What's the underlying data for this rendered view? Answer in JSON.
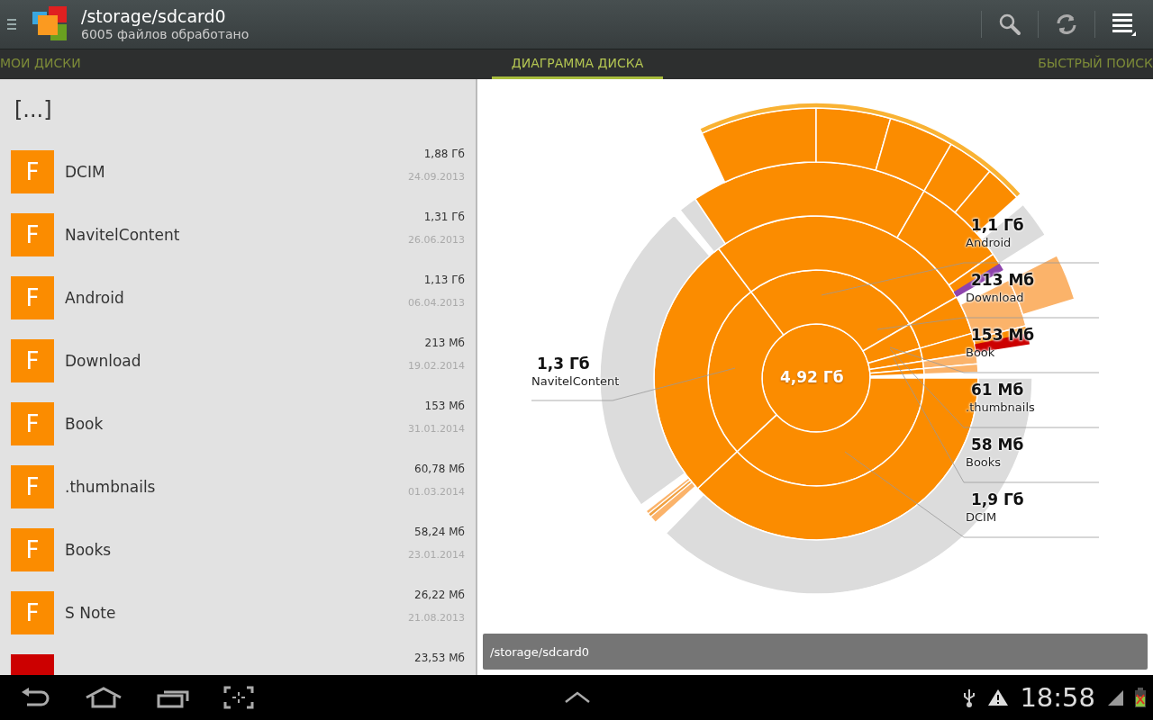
{
  "action_bar": {
    "title": "/storage/sdcard0",
    "subtitle": "6005 файлов обработано"
  },
  "tabs": [
    {
      "label": "МОИ ДИСКИ",
      "selected": false
    },
    {
      "label": "ДИАГРАММА ДИСКА",
      "selected": true
    },
    {
      "label": "БЫСТРЫЙ ПОИСК",
      "selected": false
    }
  ],
  "parent_entry": "[...]",
  "folders": [
    {
      "icon_letter": "F",
      "name": "DCIM",
      "size": "1,88 Гб",
      "date": "24.09.2013",
      "color": "#fb8c00"
    },
    {
      "icon_letter": "F",
      "name": "NavitelContent",
      "size": "1,31 Гб",
      "date": "26.06.2013",
      "color": "#fb8c00"
    },
    {
      "icon_letter": "F",
      "name": "Android",
      "size": "1,13 Гб",
      "date": "06.04.2013",
      "color": "#fb8c00"
    },
    {
      "icon_letter": "F",
      "name": "Download",
      "size": "213 Мб",
      "date": "19.02.2014",
      "color": "#fb8c00"
    },
    {
      "icon_letter": "F",
      "name": "Book",
      "size": "153 Мб",
      "date": "31.01.2014",
      "color": "#fb8c00"
    },
    {
      "icon_letter": "F",
      "name": ".thumbnails",
      "size": "60,78 Мб",
      "date": "01.03.2014",
      "color": "#fb8c00"
    },
    {
      "icon_letter": "F",
      "name": "Books",
      "size": "58,24 Мб",
      "date": "23.01.2014",
      "color": "#fb8c00"
    },
    {
      "icon_letter": "F",
      "name": "S Note",
      "size": "26,22 Мб",
      "date": "21.08.2013",
      "color": "#fb8c00"
    },
    {
      "size": "23,53 Мб",
      "color": "#cc0000"
    }
  ],
  "diagram": {
    "total": "4,92 Гб",
    "labels": [
      {
        "value": "1,3 Гб",
        "name": "NavitelContent"
      },
      {
        "value": "1,1 Гб",
        "name": "Android"
      },
      {
        "value": "213 Мб",
        "name": "Download"
      },
      {
        "value": "153 Мб",
        "name": "Book"
      },
      {
        "value": "61 Мб",
        "name": ".thumbnails"
      },
      {
        "value": "58 Мб",
        "name": "Books"
      },
      {
        "value": "1,9 Гб",
        "name": "DCIM"
      }
    ]
  },
  "path_bar": "/storage/sdcard0",
  "system_bar": {
    "time": "18:58"
  }
}
